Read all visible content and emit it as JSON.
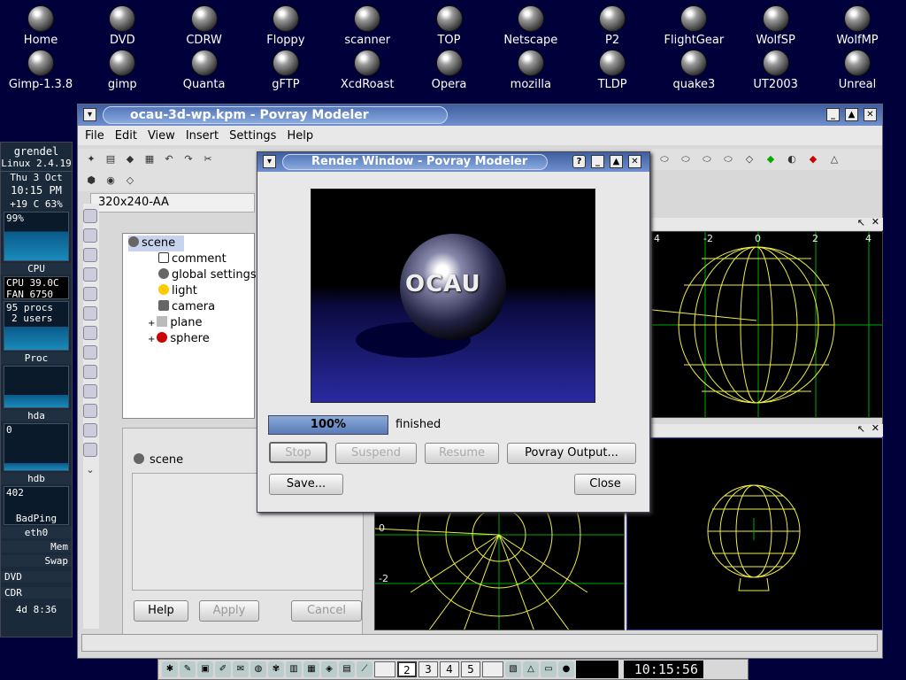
{
  "desktop": {
    "icons_row1": [
      "Home",
      "DVD",
      "CDRW",
      "Floppy",
      "scanner",
      "TOP",
      "Netscape",
      "P2",
      "FlightGear",
      "WolfSP",
      "WolfMP"
    ],
    "icons_row2": [
      "Gimp-1.3.8",
      "gimp",
      "Quanta",
      "gFTP",
      "XcdRoast",
      "Opera",
      "mozilla",
      "TLDP",
      "quake3",
      "UT2003",
      "Unreal"
    ]
  },
  "gkrellm": {
    "host": "grendel",
    "kernel": "Linux 2.4.19",
    "date": "Thu  3 Oct",
    "time": "10:15 PM",
    "temp": "+19 C 63%",
    "cpu_pct": "99%",
    "cpu_label": "CPU",
    "cpu_temp": "CPU  39.0C",
    "fan": "FAN  6750",
    "procs": "95 procs",
    "users": "2 users",
    "proc_label": "Proc",
    "hda_label": "hda",
    "hdb_val": "0",
    "hdb_label": "hdb",
    "ping_val": "402",
    "ping_label": "BadPing",
    "net_label": "eth0",
    "mem_label": "Mem",
    "swap_label": "Swap",
    "dvd_label": "DVD",
    "cdr_label": "CDR",
    "uptime": "4d  8:36"
  },
  "main": {
    "title": "ocau-3d-wp.kpm - Povray Modeler",
    "menu": [
      "File",
      "Edit",
      "View",
      "Insert",
      "Settings",
      "Help"
    ],
    "render_mode": "320x240-AA",
    "tree": {
      "root": "scene",
      "children": [
        "comment",
        "global settings",
        "light",
        "camera",
        "plane",
        "sphere"
      ]
    },
    "properties_title": "scene",
    "buttons": {
      "help": "Help",
      "apply": "Apply",
      "cancel": "Cancel"
    },
    "axis_labels_top": [
      "4",
      "-2",
      "0",
      "2",
      "4"
    ],
    "axis_labels_bottom": [
      "0",
      "-2"
    ]
  },
  "render_window": {
    "title": "Render Window - Povray Modeler",
    "image_text": "OCAU",
    "progress": 100,
    "progress_label": "100%",
    "status": "finished",
    "buttons": {
      "stop": "Stop",
      "suspend": "Suspend",
      "resume": "Resume",
      "output": "Povray Output...",
      "save": "Save...",
      "close": "Close"
    }
  },
  "taskbar": {
    "desktops": [
      "2",
      "3",
      "4",
      "5"
    ],
    "clock": "10:15:56"
  }
}
